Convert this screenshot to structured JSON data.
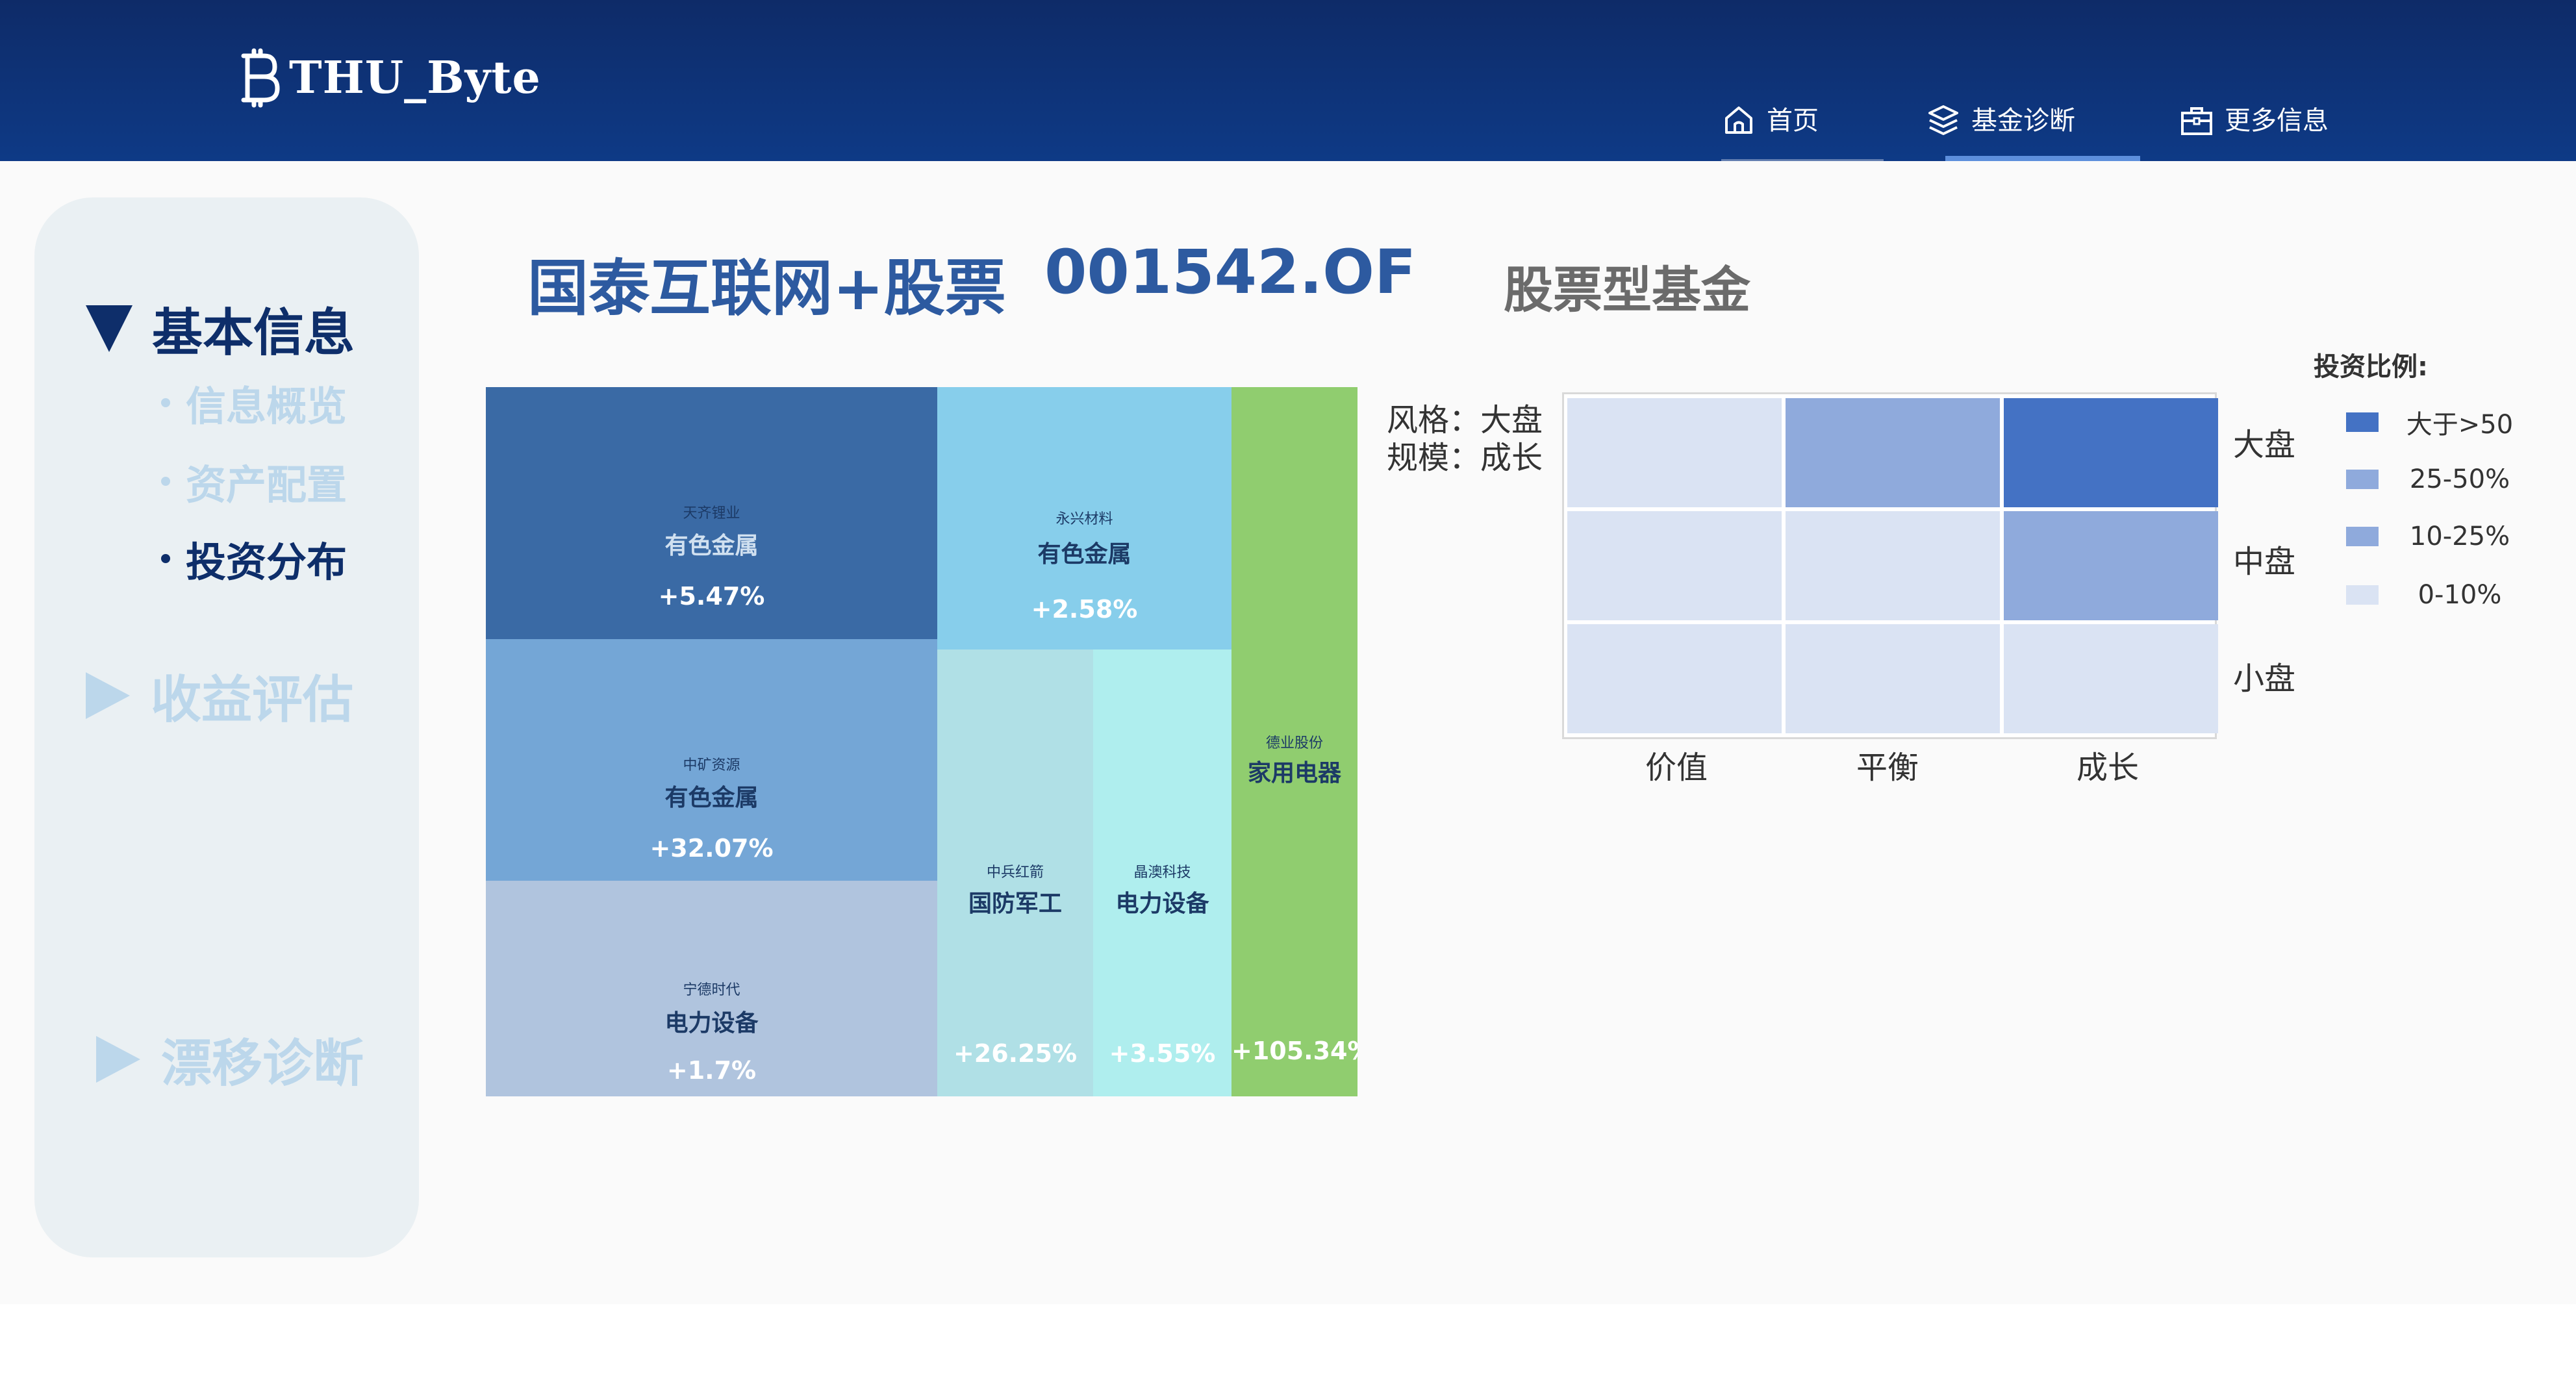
{
  "header": {
    "logo_text": "THU_Byte",
    "nav": [
      {
        "label": "首页",
        "icon": "home-icon"
      },
      {
        "label": "基金诊断",
        "icon": "layers-icon"
      },
      {
        "label": "更多信息",
        "icon": "briefcase-icon"
      }
    ],
    "active_nav": "基金诊断"
  },
  "sidebar": {
    "sections": [
      {
        "label": "基本信息",
        "expanded": true
      },
      {
        "label": "收益评估",
        "expanded": false
      },
      {
        "label": "漂移诊断",
        "expanded": false
      }
    ],
    "sub_items": [
      {
        "label": "信息概览",
        "active": false
      },
      {
        "label": "资产配置",
        "active": false
      },
      {
        "label": "投资分布",
        "active": true
      }
    ]
  },
  "fund": {
    "name": "国泰互联网+股票",
    "code": "001542.OF",
    "type": "股票型基金"
  },
  "treemap": [
    {
      "company": "天齐锂业",
      "industry": "有色金属",
      "change": "+5.47%",
      "color": "#3a6aa5",
      "company_color": "#1c3a66",
      "industry_color": "#a8c4e4",
      "change_color": "#ffffff"
    },
    {
      "company": "中矿资源",
      "industry": "有色金属",
      "change": "+32.07%",
      "color": "#74a6d6",
      "company_color": "#1c3a66",
      "industry_color": "#1c3a66",
      "change_color": "#ffffff"
    },
    {
      "company": "宁德时代",
      "industry": "电力设备",
      "change": "+1.7%",
      "color": "#b0c4de",
      "company_color": "#1c3a66",
      "industry_color": "#1c3a66",
      "change_color": "#ffffff"
    },
    {
      "company": "永兴材料",
      "industry": "有色金属",
      "change": "+2.58%",
      "color": "#87ceeb",
      "company_color": "#1c3a66",
      "industry_color": "#1c3a66",
      "change_color": "#ffffff"
    },
    {
      "company": "中兵红箭",
      "industry": "国防军工",
      "change": "+26.25%",
      "color": "#b0e0e6",
      "company_color": "#1c3a66",
      "industry_color": "#1c3a66",
      "change_color": "#ffffff"
    },
    {
      "company": "晶澳科技",
      "industry": "电力设备",
      "change": "+3.55%",
      "color": "#afeeee",
      "company_color": "#1c3a66",
      "industry_color": "#1c3a66",
      "change_color": "#ffffff"
    },
    {
      "company": "德业股份",
      "industry": "家用电器",
      "change": "+105.34%",
      "color": "#90cd6f",
      "company_color": "#1c3a66",
      "industry_color": "#1c3a66",
      "change_color": "#ffffff"
    }
  ],
  "style_box": {
    "style_label": "风格：大盘",
    "scale_label": "规模：成长",
    "columns": [
      "价值",
      "平衡",
      "成长"
    ],
    "rows": [
      "大盘",
      "中盘",
      "小盘"
    ],
    "cells": [
      [
        "0-10%",
        "25-50%",
        "大于>50"
      ],
      [
        "0-10%",
        "0-10%",
        "25-50%"
      ],
      [
        "0-10%",
        "0-10%",
        "0-10%"
      ]
    ],
    "legend_title": "投资比例:",
    "legend": [
      {
        "label": "大于>50",
        "color": "#4472c4"
      },
      {
        "label": "25-50%",
        "color": "#8faadc"
      },
      {
        "label": "10-25%",
        "color": "#8faadc"
      },
      {
        "label": "0-10%",
        "color": "#dae3f3"
      }
    ]
  }
}
